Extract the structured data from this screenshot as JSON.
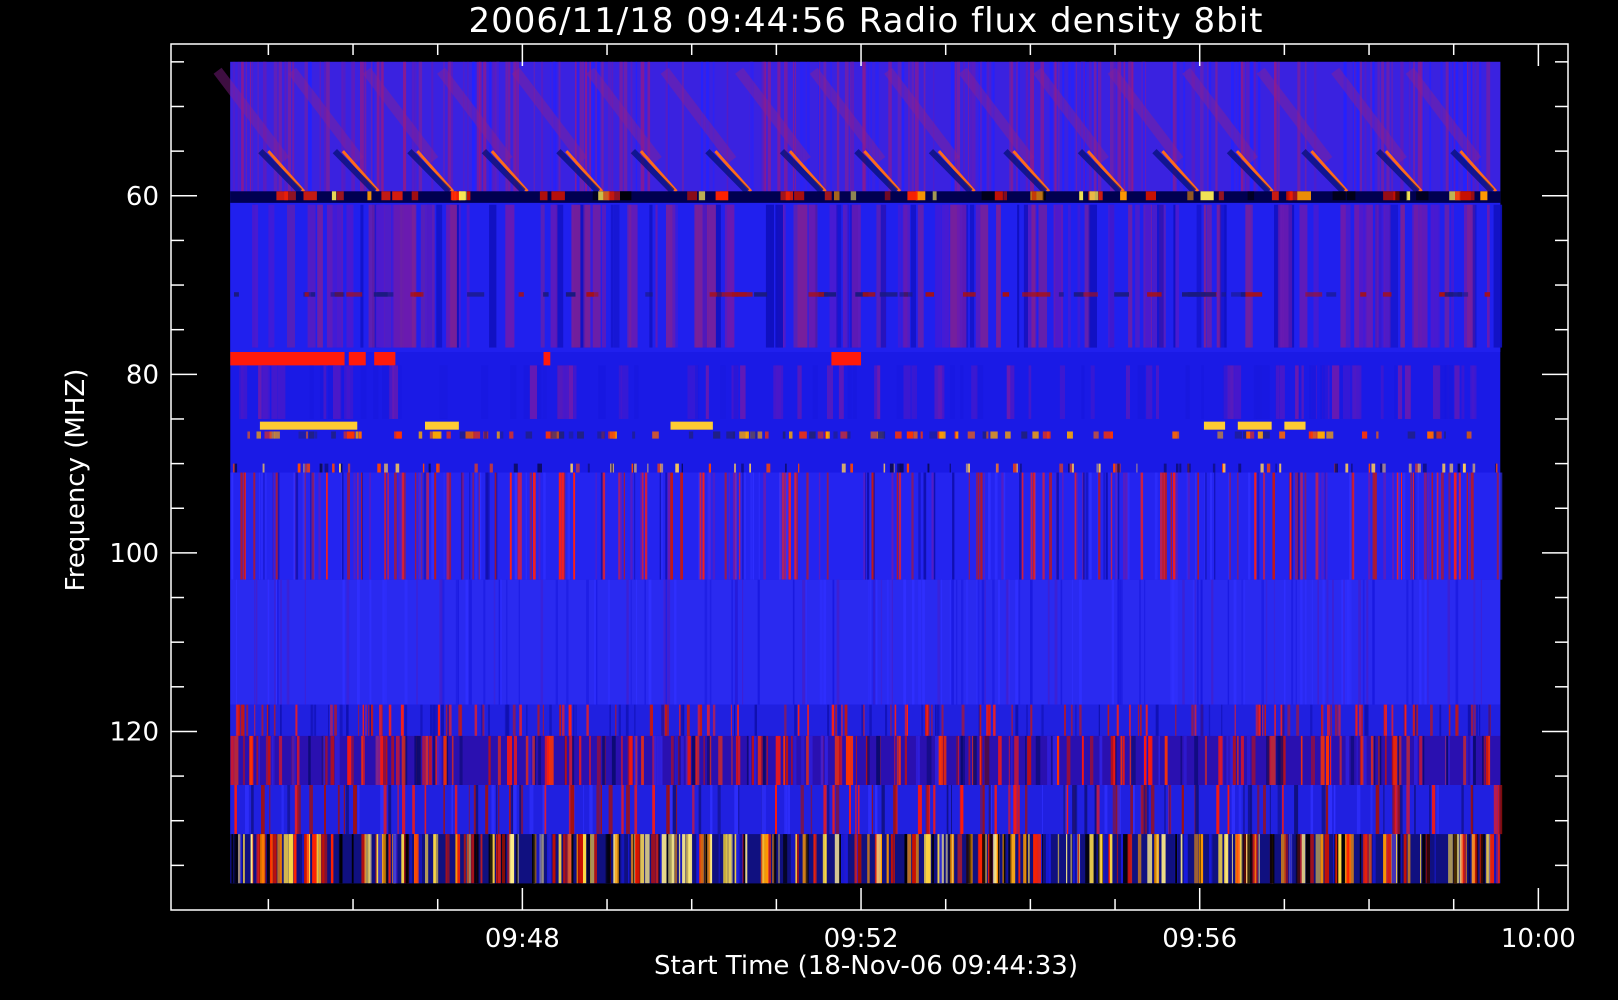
{
  "chart_data": {
    "type": "heatmap",
    "title": "2006/11/18 09:44:56 Radio flux density 8bit",
    "xlabel": "Start Time (18-Nov-06 09:44:33)",
    "ylabel": "Frequency (MHZ)",
    "x_ticks": [
      {
        "label": "09:48",
        "minutes": 3.45
      },
      {
        "label": "09:52",
        "minutes": 7.45
      },
      {
        "label": "09:56",
        "minutes": 11.45
      },
      {
        "label": "10:00",
        "minutes": 15.45
      }
    ],
    "x_minor_step_minutes": 1,
    "xlim_minutes": [
      -0.7,
      15.8
    ],
    "y_ticks": [
      60,
      80,
      100,
      120
    ],
    "y_minor_step": 5,
    "ylim": [
      140,
      43
    ],
    "y_inverted": true,
    "data_range_minutes": [
      0,
      15.0
    ],
    "data_range_freq": [
      45,
      137
    ],
    "colormap": [
      "#000000",
      "#0000ff",
      "#ff0000",
      "#ffff66"
    ],
    "bands": [
      {
        "from": 45,
        "to": 55,
        "level": "blue-purple",
        "note": "diagonal drifting structures"
      },
      {
        "from": 59.5,
        "to": 60.8,
        "level": "mixed dark/red/yellow"
      },
      {
        "from": 77.5,
        "to": 79,
        "level": "red segments"
      },
      {
        "from": 85,
        "to": 87,
        "level": "yellow-red segments"
      },
      {
        "from": 90,
        "to": 103,
        "level": "blue with red vertical streaks"
      },
      {
        "from": 103,
        "to": 117,
        "level": "uniform blue"
      },
      {
        "from": 117,
        "to": 126,
        "level": "blue/red vertical streaks"
      },
      {
        "from": 126,
        "to": 132,
        "level": "blue with red patches"
      },
      {
        "from": 132,
        "to": 137,
        "level": "strong yellow/red/dark streaks"
      }
    ]
  }
}
